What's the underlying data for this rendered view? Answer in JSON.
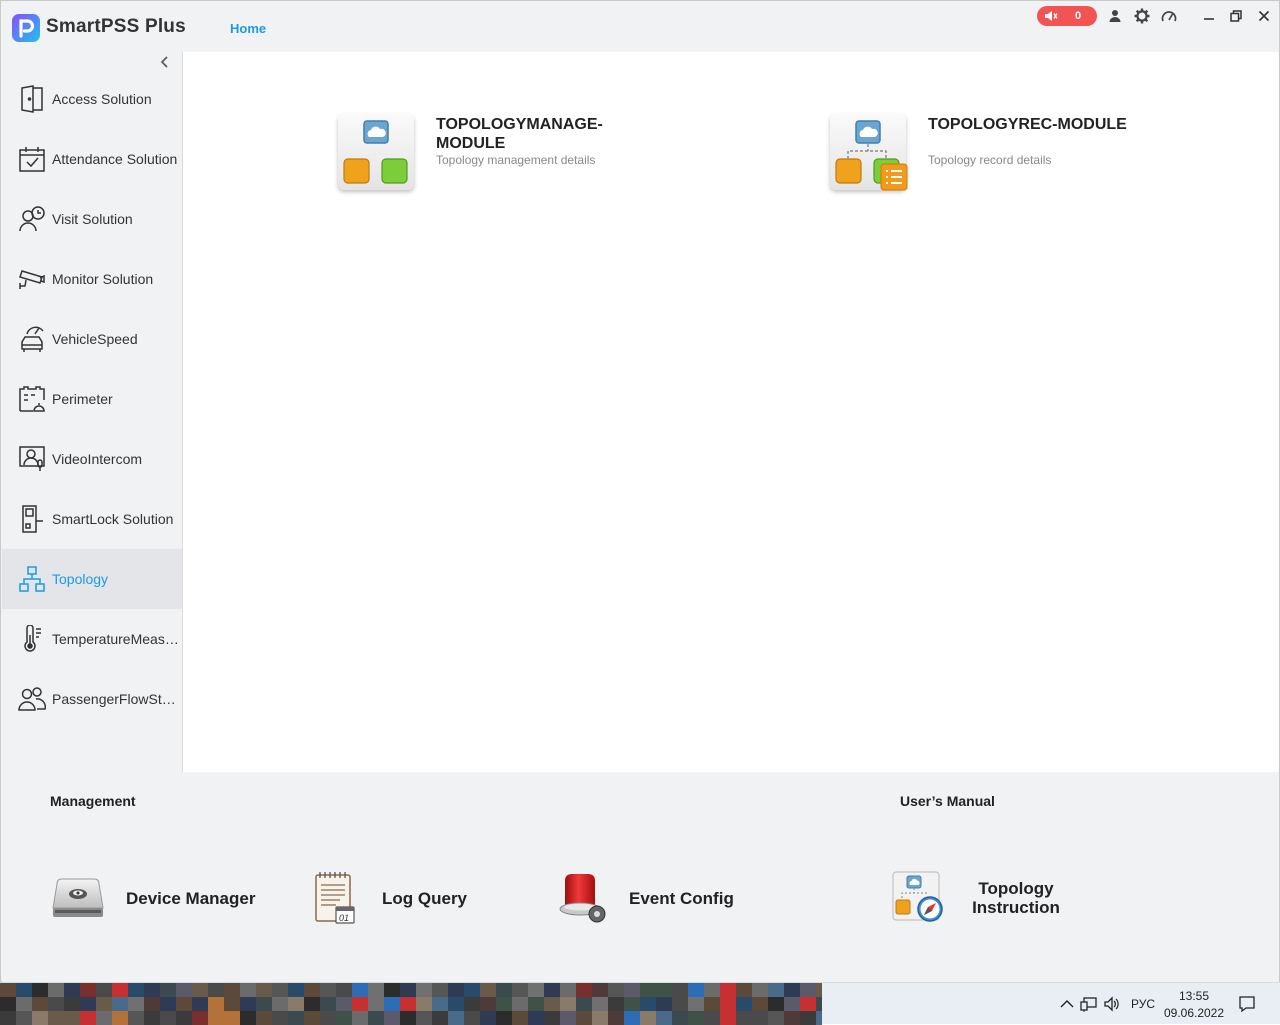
{
  "app": {
    "title": "SmartPSS Plus",
    "home_tab": "Home",
    "alarm_count": "0",
    "accent_color": "#1a9be6",
    "alarm_color": "#f25353"
  },
  "titlebar_icons": [
    "speaker-icon",
    "user-icon",
    "gear-icon",
    "gauge-icon",
    "minimize-icon",
    "restore-icon",
    "close-icon"
  ],
  "sidebar": {
    "items": [
      {
        "label": "Access Solution",
        "icon": "door-icon"
      },
      {
        "label": "Attendance Solution",
        "icon": "calendar-check-icon"
      },
      {
        "label": "Visit Solution",
        "icon": "visitor-clock-icon"
      },
      {
        "label": "Monitor Solution",
        "icon": "cctv-camera-icon"
      },
      {
        "label": "VehicleSpeed",
        "icon": "car-speed-icon"
      },
      {
        "label": "Perimeter",
        "icon": "perimeter-icon"
      },
      {
        "label": "VideoIntercom",
        "icon": "intercom-icon"
      },
      {
        "label": "SmartLock Solution",
        "icon": "smartlock-icon"
      },
      {
        "label": "Topology",
        "icon": "topology-icon",
        "active": true
      },
      {
        "label": "TemperatureMeasurement",
        "icon": "thermometer-icon"
      },
      {
        "label": "PassengerFlowStatistics",
        "icon": "people-icon"
      }
    ]
  },
  "modules": [
    {
      "title": "TOPOLOGYMANAGE-MODULE",
      "desc": "Topology management details"
    },
    {
      "title": "TOPOLOGYREC-MODULE",
      "desc": "Topology record details"
    }
  ],
  "bottom": {
    "management_title": "Management",
    "manual_title": "User’s Manual",
    "tools": [
      {
        "label": "Device Manager",
        "icon": "device-manager-icon"
      },
      {
        "label": "Log Query",
        "icon": "log-query-icon"
      },
      {
        "label": "Event Config",
        "icon": "siren-icon"
      }
    ],
    "manual": {
      "label": "Topology Instruction",
      "icon": "topology-instruction-icon"
    }
  },
  "taskbar": {
    "lang": "РУС",
    "time": "13:55",
    "date": "09.06.2022"
  }
}
